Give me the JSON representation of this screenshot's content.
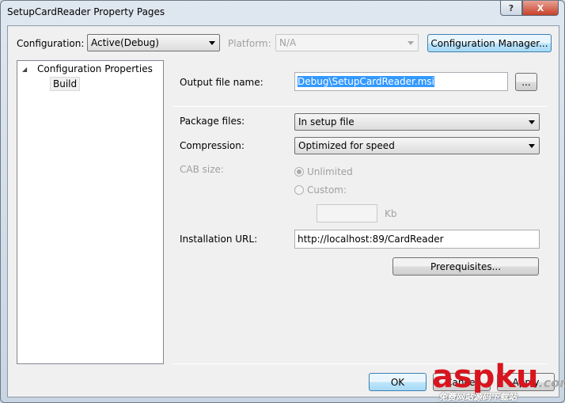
{
  "window": {
    "title": "SetupCardReader Property Pages",
    "help": "?",
    "close": "X"
  },
  "config": {
    "label": "Configuration:",
    "value": "Active(Debug)",
    "platform_label": "Platform:",
    "platform_value": "N/A",
    "manager_button": "Configuration Manager..."
  },
  "tree": {
    "root": "Configuration Properties",
    "child": "Build"
  },
  "form": {
    "output_label": "Output file name:",
    "output_value": "Debug\\SetupCardReader.msi",
    "browse": "...",
    "package_label": "Package files:",
    "package_value": "In setup file",
    "compression_label": "Compression:",
    "compression_value": "Optimized for speed",
    "cab_label": "CAB size:",
    "unlimited": "Unlimited",
    "custom": "Custom:",
    "custom_value": "",
    "kb": "Kb",
    "url_label": "Installation URL:",
    "url_value": "http://localhost:89/CardReader",
    "prereq_button": "Prerequisites..."
  },
  "buttons": {
    "ok": "OK",
    "cancel": "Cancel",
    "apply": "Apply"
  },
  "watermark": {
    "brand": "aspku",
    "suffix": ".com",
    "tagline": "免费网站源码下载站"
  }
}
